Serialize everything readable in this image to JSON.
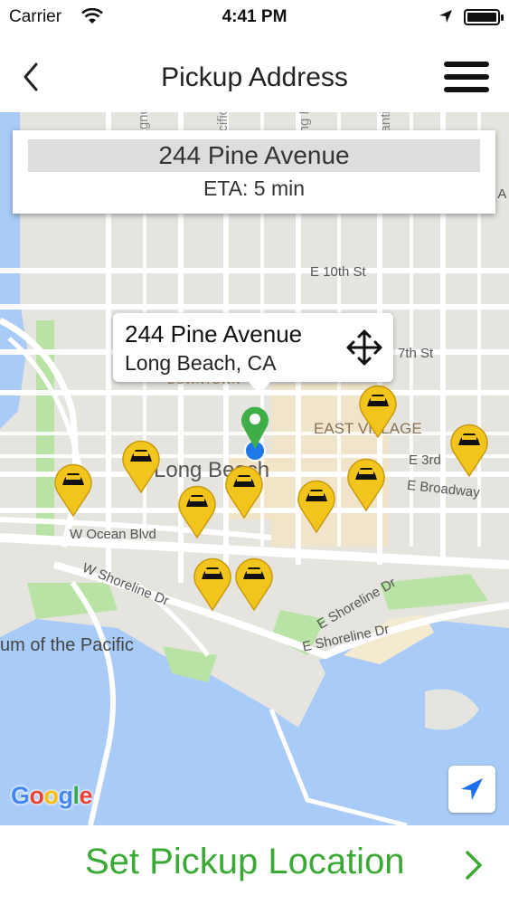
{
  "status_bar": {
    "carrier": "Carrier",
    "time": "4:41 PM",
    "icons": [
      "wifi-icon",
      "location-arrow-icon",
      "battery-icon"
    ]
  },
  "nav": {
    "title": "Pickup Address",
    "back_icon": "chevron-left-icon",
    "menu_icon": "hamburger-menu-icon"
  },
  "address_card": {
    "address": "244 Pine Avenue",
    "eta": "ETA: 5 min"
  },
  "callout": {
    "title": "244 Pine Avenue",
    "subtitle": "Long Beach, CA",
    "icon": "move-arrows-icon"
  },
  "map_labels": {
    "street_10th": "E 10th St",
    "street_7th": "7th St",
    "street_3rd": "E 3rd",
    "broadway": "E Broadway",
    "ocean": "W Ocean Blvd",
    "w_shoreline": "W Shoreline Dr",
    "e_shoreline_top": "E Shoreline Dr",
    "e_shoreline_bottom": "E Shoreline Dr",
    "east_village": "EAST VILLAGE",
    "long_beach": "Long Beach",
    "aquarium": "um of the Pacific",
    "magnolia": "Magnolia A",
    "pacific": "Pacific A",
    "long_beach_bl": "Long Beach Bl",
    "atlantic": "Atlantic A",
    "ea": "E A",
    "downtown": "DOWNTOWN"
  },
  "map": {
    "attribution": "Google",
    "locate_icon": "location-arrow-icon",
    "taxi_icon": "taxi-pin-icon",
    "pickup_pin_icon": "green-location-pin-icon"
  },
  "action": {
    "label": "Set Pickup Location",
    "icon": "chevron-right-icon"
  },
  "colors": {
    "action_green": "#3aaa35",
    "taxi_yellow": "#f2c51c",
    "pin_green": "#3fae49",
    "water": "#a9cbf7",
    "park": "#b9e3a5"
  }
}
